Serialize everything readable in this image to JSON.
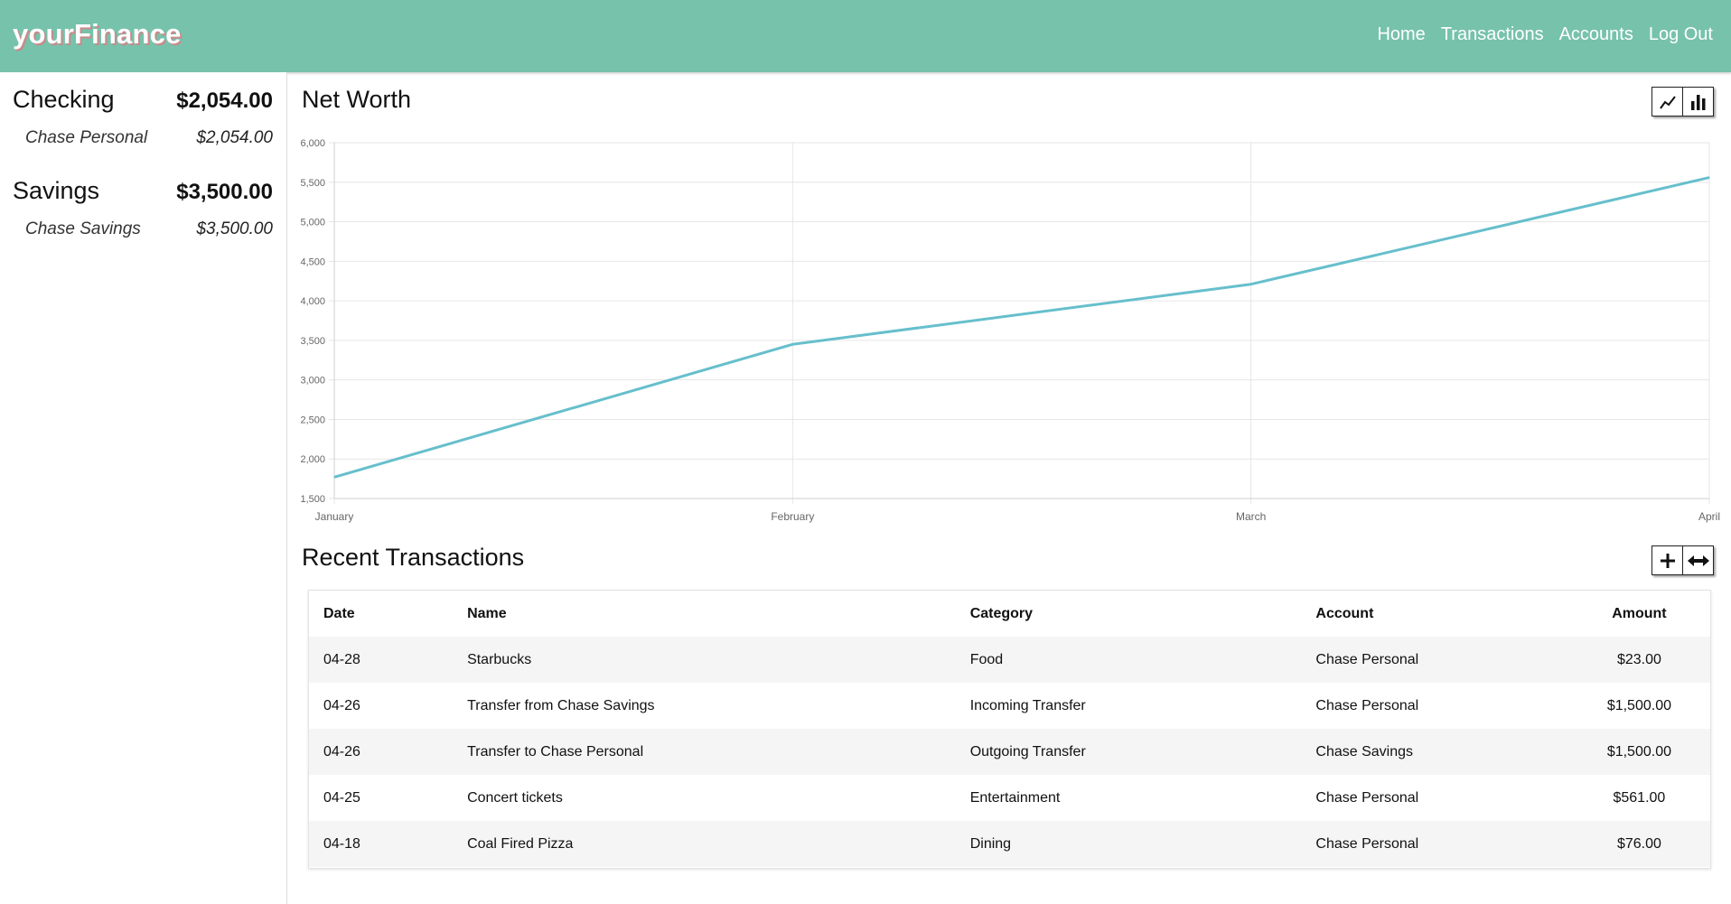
{
  "brand": "yourFinance",
  "nav": [
    "Home",
    "Transactions",
    "Accounts",
    "Log Out"
  ],
  "sidebar": {
    "groups": [
      {
        "type": "Checking",
        "total": "$2,054.00",
        "accounts": [
          {
            "name": "Chase Personal",
            "balance": "$2,054.00"
          }
        ]
      },
      {
        "type": "Savings",
        "total": "$3,500.00",
        "accounts": [
          {
            "name": "Chase Savings",
            "balance": "$3,500.00"
          }
        ]
      }
    ]
  },
  "net_worth": {
    "title": "Net Worth",
    "tools": {
      "line_icon": "line-chart-icon",
      "bar_icon": "bar-chart-icon"
    }
  },
  "chart_data": {
    "type": "line",
    "title": "Net Worth",
    "categories": [
      "January",
      "February",
      "March",
      "April"
    ],
    "series": [
      {
        "values": [
          1770,
          3450,
          4210,
          5560
        ]
      }
    ],
    "ylim": [
      1500,
      6000
    ],
    "yticks": [
      "1,500",
      "2,000",
      "2,500",
      "3,000",
      "3,500",
      "4,000",
      "4,500",
      "5,000",
      "5,500",
      "6,000"
    ],
    "ytick_values": [
      1500,
      2000,
      2500,
      3000,
      3500,
      4000,
      4500,
      5000,
      5500,
      6000
    ],
    "grid": true,
    "line_color": "#66bfcc"
  },
  "recent": {
    "title": "Recent Transactions",
    "tools": {
      "add_icon": "plus-icon",
      "transfer_icon": "transfer-icon"
    },
    "columns": [
      "Date",
      "Name",
      "Category",
      "Account",
      "Amount"
    ],
    "rows": [
      {
        "date": "04-28",
        "name": "Starbucks",
        "category": "Food",
        "account": "Chase Personal",
        "amount": "$23.00"
      },
      {
        "date": "04-26",
        "name": "Transfer from Chase Savings",
        "category": "Incoming Transfer",
        "account": "Chase Personal",
        "amount": "$1,500.00"
      },
      {
        "date": "04-26",
        "name": "Transfer to Chase Personal",
        "category": "Outgoing Transfer",
        "account": "Chase Savings",
        "amount": "$1,500.00"
      },
      {
        "date": "04-25",
        "name": "Concert tickets",
        "category": "Entertainment",
        "account": "Chase Personal",
        "amount": "$561.00"
      },
      {
        "date": "04-18",
        "name": "Coal Fired Pizza",
        "category": "Dining",
        "account": "Chase Personal",
        "amount": "$76.00"
      }
    ]
  }
}
